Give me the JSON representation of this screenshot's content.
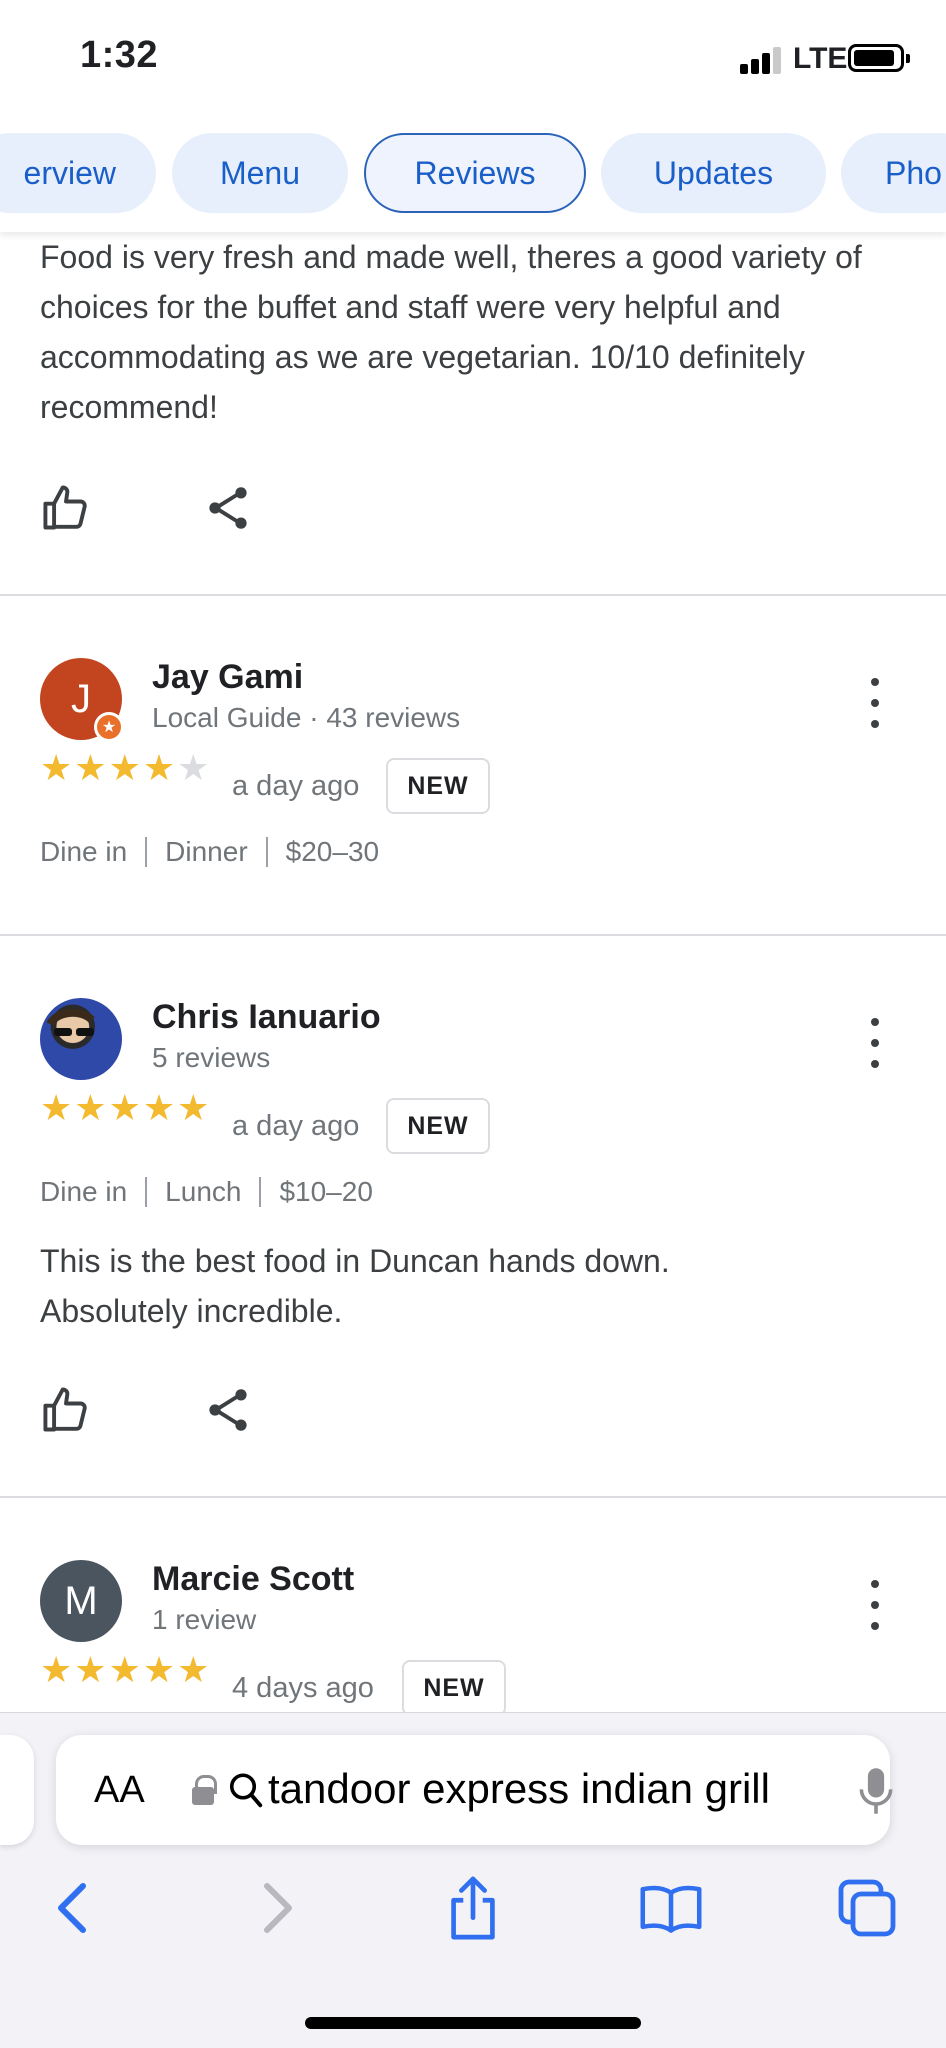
{
  "status_bar": {
    "time": "1:32",
    "network": "LTE"
  },
  "tabs": [
    {
      "label": "Overview",
      "visible_label": "erview",
      "active": false
    },
    {
      "label": "Menu",
      "active": false
    },
    {
      "label": "Reviews",
      "active": true
    },
    {
      "label": "Updates",
      "active": false
    },
    {
      "label": "Photos",
      "visible_label": "Pho",
      "active": false
    }
  ],
  "reviews": [
    {
      "partial": true,
      "text": "Food is very fresh and made well, theres a good variety of choices for the buffet and staff were very helpful and accommodating as we are vegetarian. 10/10 definitely recommend!"
    },
    {
      "name": "Jay Gami",
      "avatar_initial": "J",
      "avatar_color": "#c2451f",
      "local_guide": true,
      "meta": "Local Guide · 43 reviews",
      "rating": 4,
      "when": "a day ago",
      "badge": "NEW",
      "details": [
        "Dine in",
        "Dinner",
        "$20–30"
      ]
    },
    {
      "name": "Chris Ianuario",
      "avatar_initial": "",
      "avatar_color": "#1e3a8a",
      "local_guide": false,
      "meta": "5 reviews",
      "rating": 5,
      "when": "a day ago",
      "badge": "NEW",
      "details": [
        "Dine in",
        "Lunch",
        "$10–20"
      ],
      "text": "This is the best food in Duncan hands down. Absolutely incredible."
    },
    {
      "name": "Marcie Scott",
      "avatar_initial": "M",
      "avatar_color": "#4a5560",
      "local_guide": false,
      "meta": "1 review",
      "rating": 5,
      "when": "4 days ago",
      "badge": "NEW"
    }
  ],
  "browser": {
    "text_size_label": "AA",
    "url_query": "tandoor express indian grill",
    "icons": [
      "lock-icon",
      "search-icon",
      "mic-icon",
      "back-icon",
      "forward-icon",
      "share-icon",
      "bookmarks-icon",
      "tabs-icon"
    ]
  },
  "colors": {
    "accent": "#1a5fc9",
    "star": "#f3b92f",
    "star_empty": "#dadce0",
    "tab_bg": "#e8effc"
  }
}
